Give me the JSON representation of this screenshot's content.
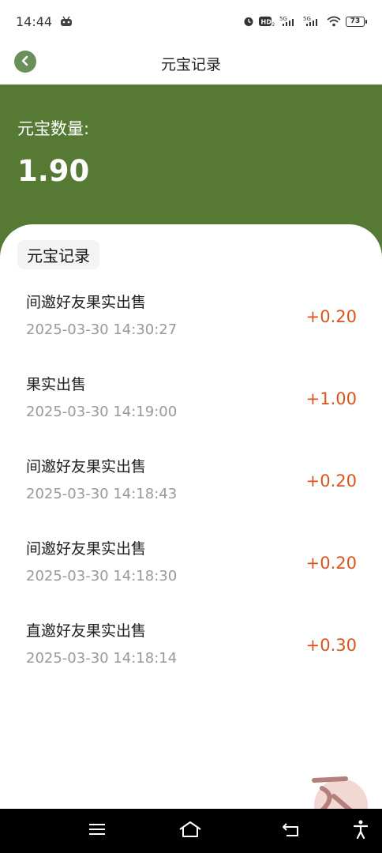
{
  "status_bar": {
    "time": "14:44",
    "battery": "73",
    "network": [
      "5G",
      "5G"
    ]
  },
  "header": {
    "title": "元宝记录"
  },
  "summary": {
    "label": "元宝数量:",
    "value": "1.90"
  },
  "records_section": {
    "title": "元宝记录",
    "items": [
      {
        "title": "间邀好友果实出售",
        "time": "2025-03-30 14:30:27",
        "amount": "+0.20"
      },
      {
        "title": "果实出售",
        "time": "2025-03-30 14:19:00",
        "amount": "+1.00"
      },
      {
        "title": "间邀好友果实出售",
        "time": "2025-03-30 14:18:43",
        "amount": "+0.20"
      },
      {
        "title": "间邀好友果实出售",
        "time": "2025-03-30 14:18:30",
        "amount": "+0.20"
      },
      {
        "title": "直邀好友果实出售",
        "time": "2025-03-30 14:18:14",
        "amount": "+0.30"
      }
    ]
  },
  "colors": {
    "header_green": "#567a34",
    "back_button": "#6b8f58",
    "amount_orange": "#d8541a"
  },
  "icons": {
    "back": "chevron-left-icon",
    "nav_menu": "menu-icon",
    "nav_home": "home-icon",
    "nav_back": "back-icon",
    "accessibility": "accessibility-icon"
  }
}
